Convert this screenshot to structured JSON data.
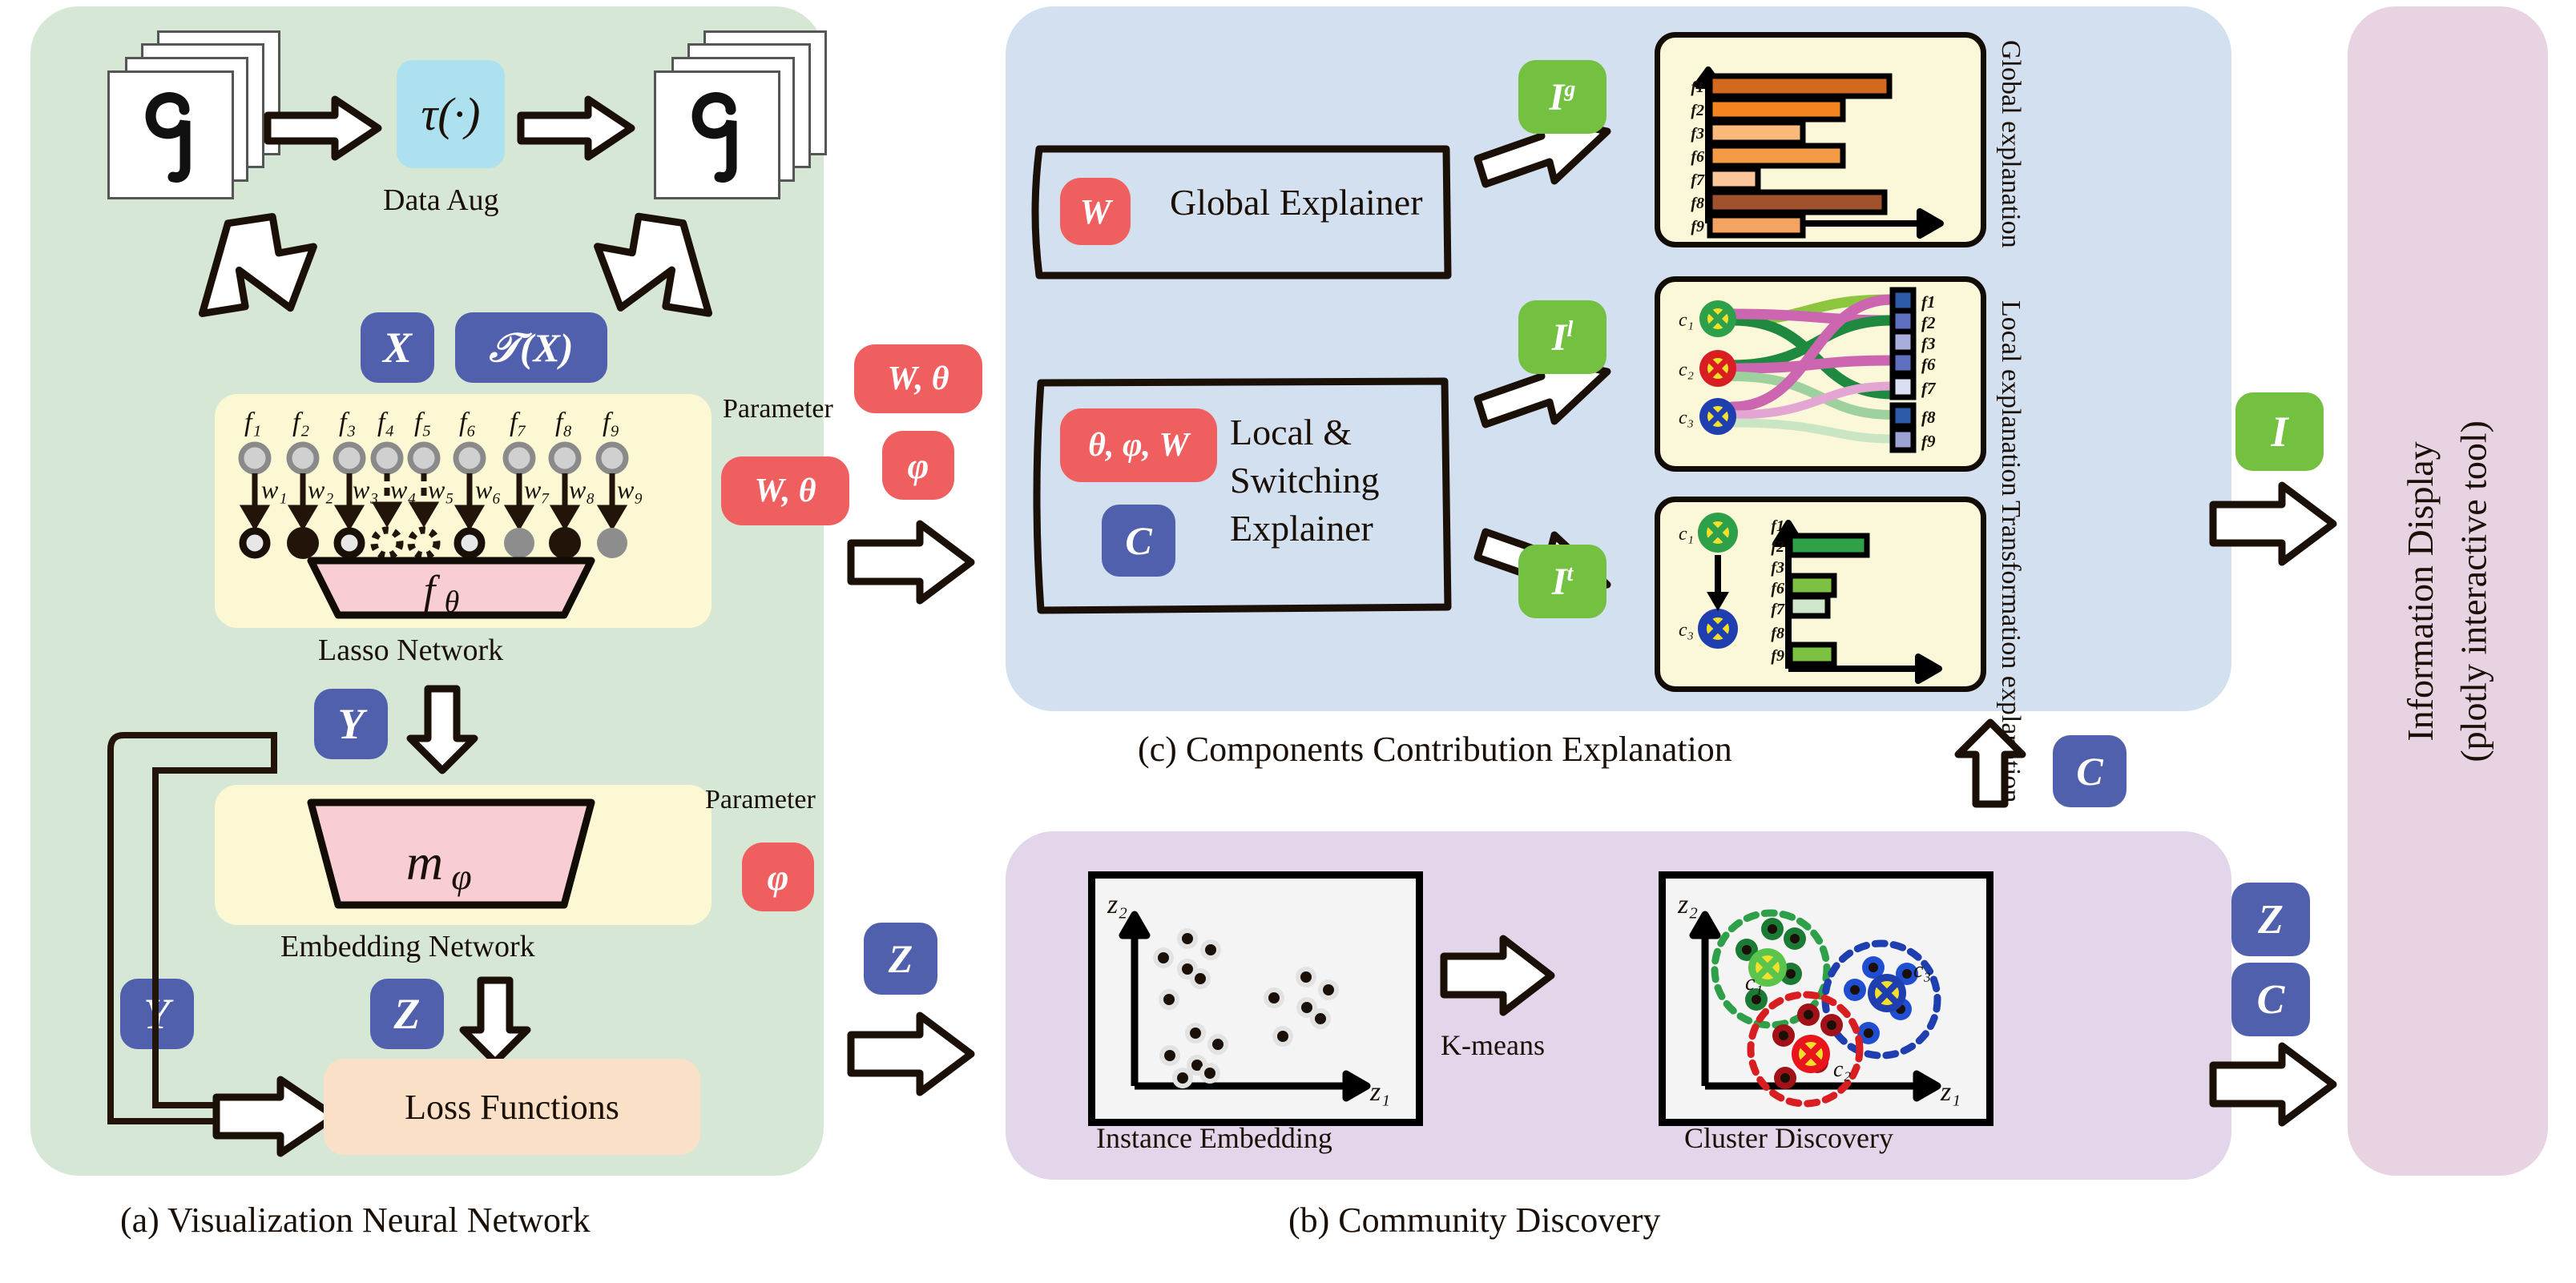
{
  "panels": {
    "a": {
      "caption": "(a) Visualization Neural Network",
      "bg": "#d6e8d5"
    },
    "b": {
      "caption": "(b) Community Discovery",
      "bg": "#e3d5ea"
    },
    "c": {
      "caption": "(c) Components Contribution Explanation",
      "bg": "#d3e0f0"
    },
    "d": {
      "title_line1": "Information Display",
      "title_line2": "(plotly interactive tool)",
      "bg": "#e8d3e2"
    }
  },
  "panel_a": {
    "aug_symbol": "τ(·)",
    "aug_caption": "Data Aug",
    "badge_x": "X",
    "badge_tx": "𝒯(X)",
    "lasso_caption": "Lasso Network",
    "lasso_fn": "fθ",
    "embed_caption": "Embedding Network",
    "embed_fn": "mφ",
    "loss_caption": "Loss Functions",
    "badge_y": "Y",
    "badge_z": "Z",
    "param_label_1": "Parameter",
    "param_value_1": "W, θ",
    "param_label_2": "Parameter",
    "param_value_2": "φ",
    "features": [
      "f1",
      "f2",
      "f3",
      "f4",
      "f5",
      "f6",
      "f7",
      "f8",
      "f9"
    ],
    "weights": [
      "w1",
      "w2",
      "w3",
      "w4",
      "w5",
      "w6",
      "w7",
      "w8",
      "w9"
    ],
    "node_styles": [
      "ring",
      "filled-black",
      "ring",
      "dotted",
      "dotted",
      "ring",
      "gray",
      "filled-black",
      "gray"
    ]
  },
  "flow_badges": {
    "wtheta": "W, θ",
    "phi": "φ",
    "c": "C",
    "z": "Z",
    "i": "I",
    "zc_z": "Z",
    "zc_c": "C"
  },
  "panel_c": {
    "global_explainer": {
      "param": "W",
      "label": "Global Explainer",
      "output": "I",
      "output_sup": "g"
    },
    "local_explainer": {
      "param": "θ, φ, W",
      "cluster": "C",
      "label_line1": "Local &",
      "label_line2": "Switching",
      "label_line3": "Explainer",
      "output_local": "I",
      "output_local_sup": "l",
      "output_trans": "I",
      "output_trans_sup": "t"
    },
    "side_labels": [
      "Global explanation",
      "Local explanation",
      "Transformation explanation"
    ]
  },
  "panel_b": {
    "left_caption": "Instance Embedding",
    "right_caption": "Cluster Discovery",
    "arrow_label": "K-means",
    "axis_x": "z1",
    "axis_y": "z2",
    "clusters": [
      "c1",
      "c2",
      "c3"
    ],
    "cluster_colors": {
      "c1": "#2ea04a",
      "c2": "#d81e20",
      "c3": "#1f3fb0"
    }
  },
  "chart_data": [
    {
      "type": "bar",
      "title": "Global explanation",
      "orientation": "horizontal",
      "categories": [
        "f1",
        "f2",
        "f3",
        "f6",
        "f7",
        "f8",
        "f9"
      ],
      "values": [
        100,
        74,
        52,
        74,
        27,
        97,
        52
      ],
      "colors": [
        "#d2691e",
        "#f4841f",
        "#fab97b",
        "#f49b45",
        "#fbc79a",
        "#a0522d",
        "#f4a460"
      ],
      "xlabel": "",
      "ylabel": "",
      "xlim": [
        0,
        110
      ],
      "grid": false,
      "legend": false
    },
    {
      "type": "heatmap",
      "title": "Local explanation",
      "row_labels": [
        "c1",
        "c2",
        "c3"
      ],
      "col_labels": [
        "f1",
        "f2",
        "f3",
        "f6",
        "f7",
        "f8",
        "f9"
      ],
      "col_colors": [
        "#2c5aa8",
        "#5f6fc0",
        "#a7aedb",
        "#5f6fc0",
        "#dcdef2",
        "#2c5aa8",
        "#9aa3d4"
      ],
      "edges": [
        {
          "from": "c1",
          "to": "f2",
          "color": "#cc66b0",
          "width": 12
        },
        {
          "from": "c1",
          "to": "f3",
          "color": "#1f8a3f",
          "width": 12
        },
        {
          "from": "c2",
          "to": "f1",
          "color": "#8cc63e",
          "width": 13
        },
        {
          "from": "c2",
          "to": "f6",
          "color": "#cc66b0",
          "width": 13
        },
        {
          "from": "c2",
          "to": "f8",
          "color": "#9ed19e",
          "width": 11
        },
        {
          "from": "c3",
          "to": "f7",
          "color": "#e3a6d2",
          "width": 10
        },
        {
          "from": "c3",
          "to": "f9",
          "color": "#c9e5c4",
          "width": 10
        }
      ]
    },
    {
      "type": "bar",
      "title": "Transformation explanation",
      "orientation": "horizontal",
      "transition_from": "c1",
      "transition_to": "c3",
      "categories": [
        "f1",
        "f2",
        "f3",
        "f6",
        "f7",
        "f8",
        "f9"
      ],
      "values": [
        0,
        96,
        0,
        55,
        47,
        0,
        55
      ],
      "colors": [
        "#2fa247",
        "#2fa247",
        "#7cc142",
        "#7cc142",
        "#cfe8cc",
        "#7cc142",
        "#7cc142"
      ],
      "xlabel": "",
      "ylabel": "",
      "xlim": [
        0,
        110
      ],
      "grid": false,
      "legend": false
    },
    {
      "type": "scatter",
      "title": "Instance Embedding",
      "xlabel": "z1",
      "ylabel": "z2",
      "x": [
        22,
        33,
        17,
        27,
        30,
        19,
        46,
        38,
        57,
        64,
        53,
        63,
        67,
        21,
        29,
        32,
        24,
        60
      ],
      "y": [
        84,
        78,
        76,
        72,
        70,
        58,
        48,
        43,
        46,
        55,
        62,
        52,
        48,
        36,
        32,
        28,
        18,
        43
      ],
      "point_color": "#1a1008",
      "grid": false,
      "legend": false
    },
    {
      "type": "scatter",
      "title": "Cluster Discovery",
      "xlabel": "z1",
      "ylabel": "z2",
      "series": [
        {
          "name": "c1",
          "color": "#2ea04a",
          "centroid": [
            36,
            68
          ],
          "x": [
            39,
            47,
            27,
            45,
            30
          ],
          "y": [
            84,
            79,
            74,
            67,
            57
          ]
        },
        {
          "name": "c2",
          "color": "#d81e20",
          "centroid": [
            47,
            30
          ],
          "x": [
            45,
            53,
            33,
            35
          ],
          "y": [
            42,
            38,
            36,
            19
          ]
        },
        {
          "name": "c3",
          "color": "#1f3fb0",
          "centroid": [
            78,
            55
          ],
          "x": [
            74,
            87,
            66,
            84,
            73
          ],
          "y": [
            63,
            61,
            54,
            48,
            42
          ]
        }
      ]
    }
  ]
}
